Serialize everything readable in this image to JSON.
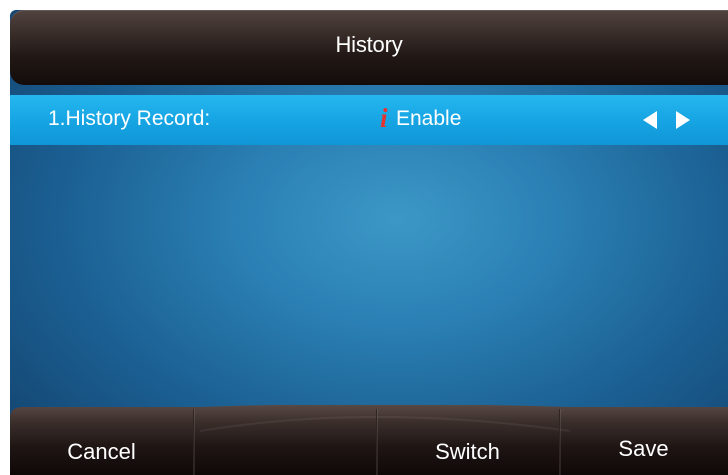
{
  "title_bar": {
    "title": "History"
  },
  "selected_row": {
    "label": "1.History Record:",
    "info_icon_glyph": "i",
    "info_icon": "info-icon",
    "value": "Enable",
    "left_arrow_icon": "left-arrow-icon",
    "right_arrow_icon": "right-arrow-icon"
  },
  "softkeys": [
    {
      "label": "Cancel"
    },
    {
      "label": ""
    },
    {
      "label": "Switch"
    },
    {
      "label": "Save"
    }
  ],
  "colors": {
    "row_highlight": "#17a5e4",
    "info_icon": "#e5342f",
    "background_center": "#3c97c6",
    "background_edge": "#123f69",
    "bar_dark": "#130c0a"
  }
}
